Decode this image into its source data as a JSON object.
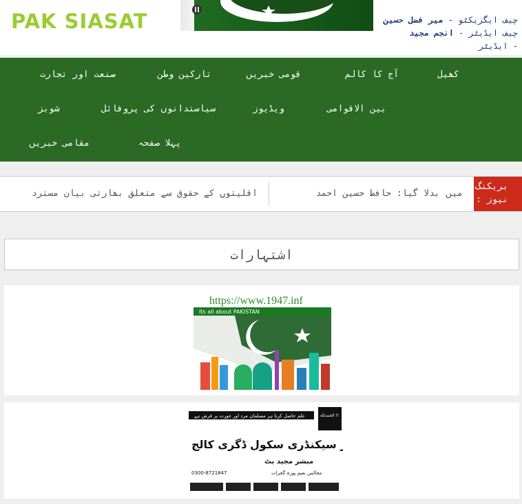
{
  "header": {
    "logo_text": "PAK SIASAT",
    "credits": [
      {
        "role": "چیف ایگزیکٹو -",
        "name": "میر فضل حسین"
      },
      {
        "role": "چیف ایڈیٹر -",
        "name": "انجم مجید"
      },
      {
        "role": "- ایڈیٹر",
        "name": ""
      }
    ]
  },
  "nav": {
    "items": [
      {
        "label": "کھیل"
      },
      {
        "label": "آج کا کالم"
      },
      {
        "label": "قومی خبریں"
      },
      {
        "label": "تارکین وطن"
      },
      {
        "label": "صنعت اور تجارت"
      },
      {
        "label": "بین الاقوامی"
      },
      {
        "label": "ویڈیوز"
      },
      {
        "label": "سیاستدانوں کی پروفائل"
      },
      {
        "label": "شوبز"
      },
      {
        "label": "پہلا صفحہ"
      },
      {
        "label": "مقامی خبریں"
      }
    ]
  },
  "ticker": {
    "label": "بریکنگ نیوز :",
    "item_1": "میں بدلا گیا: حافظ حسین احمد",
    "item_2": "اقلیتوں کے حقوق سے متعلق بھارتی بیان مسترد"
  },
  "ads": {
    "heading": "اشتہارات",
    "ad1": {
      "url": "https://www.1947.inf",
      "tagline": "Its all about PAKISTAN"
    },
    "ad2": {
      "top_line": "علم حاصل کرنا ہر مسلمان مرد اور عورت پر فرض ہے",
      "corner_text": "الحمدللہ !!",
      "title": "عبدالمجید گرلز ہائیر سیکنڈری سکول ڈگری کالج",
      "subtitle": "مبشر مجید بٹ",
      "address": "مجالس نعیم پورہ گجرات",
      "phone": "0300-8721847"
    }
  },
  "colors": {
    "nav_bg": "#2a6a24",
    "logo": "#9acd32",
    "breaking_bg": "#cc2b1c",
    "credit_text": "#1a3d7c"
  }
}
